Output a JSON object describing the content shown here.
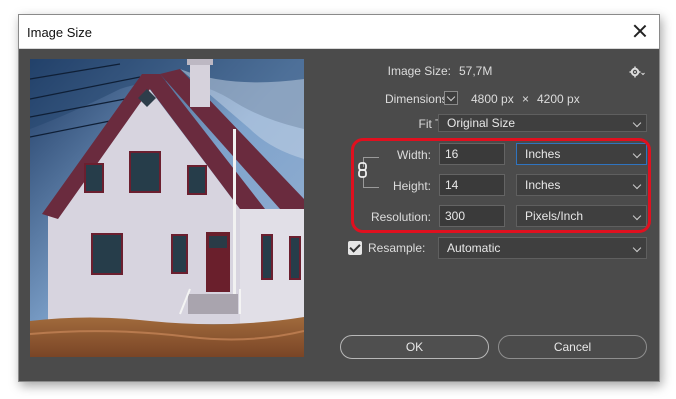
{
  "window": {
    "title": "Image Size"
  },
  "info": {
    "image_size_label": "Image Size:",
    "image_size_value": "57,7M",
    "dimensions_label": "Dimensions:",
    "dim_width": "4800 px",
    "dim_times": "×",
    "dim_height": "4200 px"
  },
  "fit_to": {
    "label": "Fit To:",
    "value": "Original Size"
  },
  "width": {
    "label": "Width:",
    "value": "16",
    "unit": "Inches"
  },
  "height": {
    "label": "Height:",
    "value": "14",
    "unit": "Inches"
  },
  "resolution": {
    "label": "Resolution:",
    "value": "300",
    "unit": "Pixels/Inch"
  },
  "resample": {
    "label": "Resample:",
    "checked": true,
    "value": "Automatic"
  },
  "buttons": {
    "ok": "OK",
    "cancel": "Cancel"
  },
  "colors": {
    "dialog_bg": "#4b4b4b",
    "highlight": "#e0101f",
    "focus": "#2f74c0"
  }
}
